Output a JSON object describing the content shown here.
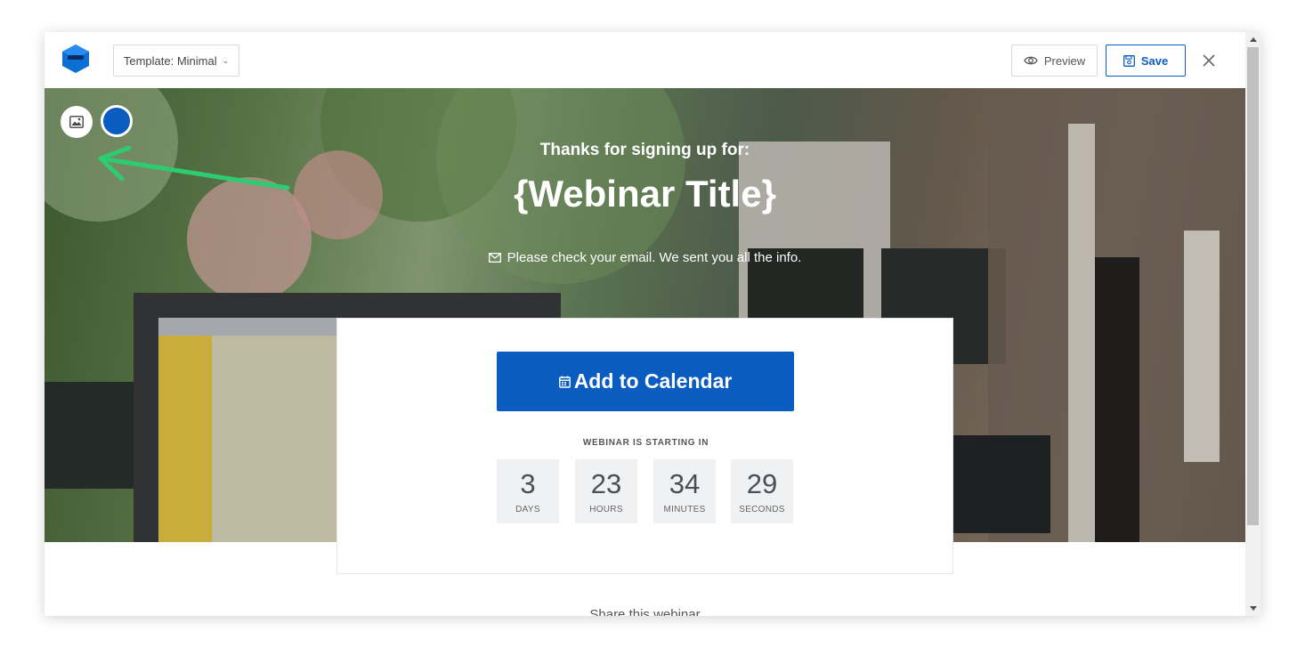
{
  "toolbar": {
    "template_label": "Template: Minimal",
    "preview_label": "Preview",
    "save_label": "Save"
  },
  "hero": {
    "subtitle": "Thanks for signing up for:",
    "title": "{Webinar Title}",
    "note": "Please check your email. We sent you all the info."
  },
  "card": {
    "calendar_button": "Add to Calendar",
    "countdown_label": "WEBINAR IS STARTING IN",
    "countdown": [
      {
        "value": "3",
        "unit": "DAYS"
      },
      {
        "value": "23",
        "unit": "HOURS"
      },
      {
        "value": "34",
        "unit": "MINUTES"
      },
      {
        "value": "29",
        "unit": "SECONDS"
      }
    ]
  },
  "footer": {
    "share_text": "Share this webinar"
  },
  "colors": {
    "accent": "#0b5cc1",
    "arrow": "#2ecc71"
  },
  "icons": [
    "logo-icon",
    "chevron-down-icon",
    "eye-icon",
    "save-icon",
    "close-icon",
    "image-icon",
    "color-swatch",
    "mail-icon",
    "calendar-icon"
  ]
}
